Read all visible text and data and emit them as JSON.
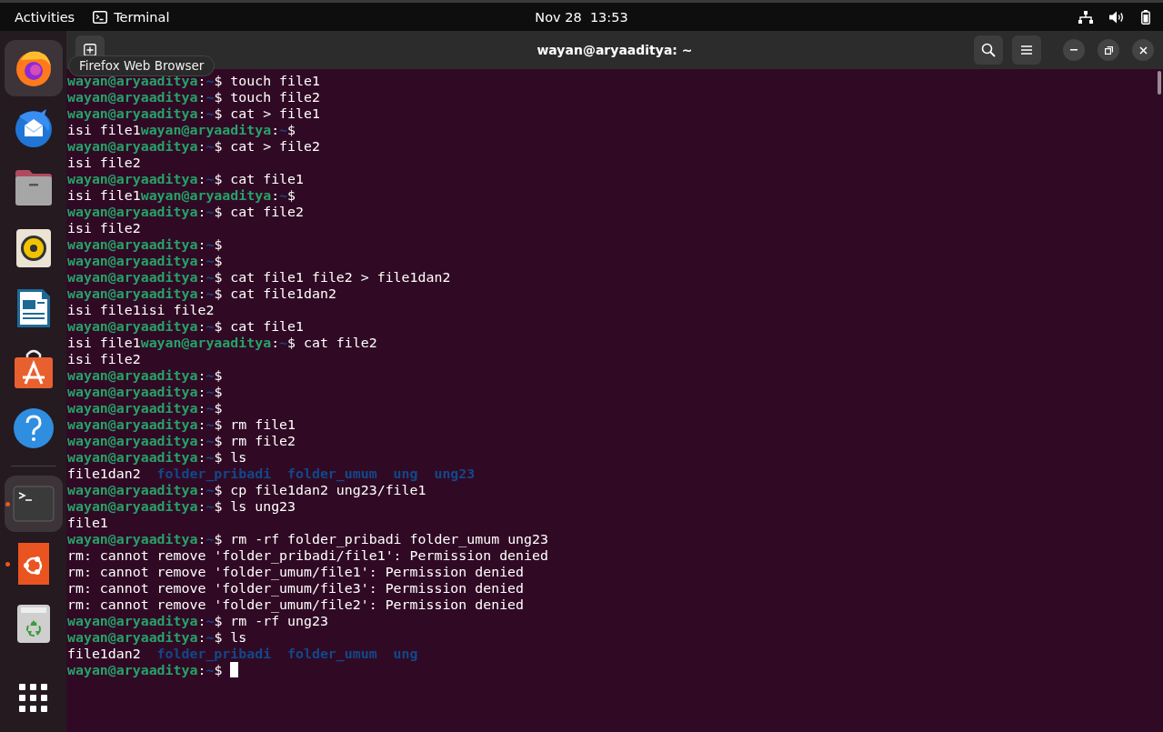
{
  "top_bar": {
    "activities": "Activities",
    "app_menu": "Terminal",
    "clock": "Nov 28  13:53"
  },
  "dock": {
    "tooltip": "Firefox Web Browser",
    "items": [
      {
        "kind": "firefox",
        "highlighted": true,
        "running": false
      },
      {
        "kind": "thunderbird",
        "highlighted": false,
        "running": false
      },
      {
        "kind": "files",
        "highlighted": false,
        "running": false
      },
      {
        "kind": "rhythmbox",
        "highlighted": false,
        "running": false
      },
      {
        "kind": "writer",
        "highlighted": false,
        "running": false
      },
      {
        "kind": "software",
        "highlighted": false,
        "running": false
      },
      {
        "kind": "help",
        "highlighted": false,
        "running": false
      },
      {
        "kind": "separator"
      },
      {
        "kind": "terminal",
        "highlighted": true,
        "running": true
      },
      {
        "kind": "ubuntu",
        "highlighted": false,
        "running": true
      },
      {
        "kind": "trash",
        "highlighted": false,
        "running": false
      },
      {
        "kind": "grid",
        "highlighted": false,
        "running": false
      }
    ]
  },
  "terminal": {
    "title": "wayan@aryaaditya: ~",
    "cursor": true,
    "lines": [
      [
        {
          "kind": "user",
          "text": "wayan@aryaaditya"
        },
        {
          "kind": "plain",
          "text": ":"
        },
        {
          "kind": "cwd",
          "text": "~"
        },
        {
          "kind": "plain",
          "text": "$ touch file1"
        }
      ],
      [
        {
          "kind": "user",
          "text": "wayan@aryaaditya"
        },
        {
          "kind": "plain",
          "text": ":"
        },
        {
          "kind": "cwd",
          "text": "~"
        },
        {
          "kind": "plain",
          "text": "$ touch file2"
        }
      ],
      [
        {
          "kind": "user",
          "text": "wayan@aryaaditya"
        },
        {
          "kind": "plain",
          "text": ":"
        },
        {
          "kind": "cwd",
          "text": "~"
        },
        {
          "kind": "plain",
          "text": "$ cat > file1"
        }
      ],
      [
        {
          "kind": "plain",
          "text": "isi file1"
        },
        {
          "kind": "user",
          "text": "wayan@aryaaditya"
        },
        {
          "kind": "plain",
          "text": ":"
        },
        {
          "kind": "cwd",
          "text": "~"
        },
        {
          "kind": "plain",
          "text": "$"
        }
      ],
      [
        {
          "kind": "user",
          "text": "wayan@aryaaditya"
        },
        {
          "kind": "plain",
          "text": ":"
        },
        {
          "kind": "cwd",
          "text": "~"
        },
        {
          "kind": "plain",
          "text": "$ cat > file2"
        }
      ],
      [
        {
          "kind": "plain",
          "text": "isi file2"
        }
      ],
      [
        {
          "kind": "user",
          "text": "wayan@aryaaditya"
        },
        {
          "kind": "plain",
          "text": ":"
        },
        {
          "kind": "cwd",
          "text": "~"
        },
        {
          "kind": "plain",
          "text": "$ cat file1"
        }
      ],
      [
        {
          "kind": "plain",
          "text": "isi file1"
        },
        {
          "kind": "user",
          "text": "wayan@aryaaditya"
        },
        {
          "kind": "plain",
          "text": ":"
        },
        {
          "kind": "cwd",
          "text": "~"
        },
        {
          "kind": "plain",
          "text": "$"
        }
      ],
      [
        {
          "kind": "user",
          "text": "wayan@aryaaditya"
        },
        {
          "kind": "plain",
          "text": ":"
        },
        {
          "kind": "cwd",
          "text": "~"
        },
        {
          "kind": "plain",
          "text": "$ cat file2"
        }
      ],
      [
        {
          "kind": "plain",
          "text": "isi file2"
        }
      ],
      [
        {
          "kind": "user",
          "text": "wayan@aryaaditya"
        },
        {
          "kind": "plain",
          "text": ":"
        },
        {
          "kind": "cwd",
          "text": "~"
        },
        {
          "kind": "plain",
          "text": "$"
        }
      ],
      [
        {
          "kind": "user",
          "text": "wayan@aryaaditya"
        },
        {
          "kind": "plain",
          "text": ":"
        },
        {
          "kind": "cwd",
          "text": "~"
        },
        {
          "kind": "plain",
          "text": "$"
        }
      ],
      [
        {
          "kind": "user",
          "text": "wayan@aryaaditya"
        },
        {
          "kind": "plain",
          "text": ":"
        },
        {
          "kind": "cwd",
          "text": "~"
        },
        {
          "kind": "plain",
          "text": "$ cat file1 file2 > file1dan2"
        }
      ],
      [
        {
          "kind": "user",
          "text": "wayan@aryaaditya"
        },
        {
          "kind": "plain",
          "text": ":"
        },
        {
          "kind": "cwd",
          "text": "~"
        },
        {
          "kind": "plain",
          "text": "$ cat file1dan2"
        }
      ],
      [
        {
          "kind": "plain",
          "text": "isi file1isi file2"
        }
      ],
      [
        {
          "kind": "user",
          "text": "wayan@aryaaditya"
        },
        {
          "kind": "plain",
          "text": ":"
        },
        {
          "kind": "cwd",
          "text": "~"
        },
        {
          "kind": "plain",
          "text": "$ cat file1"
        }
      ],
      [
        {
          "kind": "plain",
          "text": "isi file1"
        },
        {
          "kind": "user",
          "text": "wayan@aryaaditya"
        },
        {
          "kind": "plain",
          "text": ":"
        },
        {
          "kind": "cwd",
          "text": "~"
        },
        {
          "kind": "plain",
          "text": "$ cat file2"
        }
      ],
      [
        {
          "kind": "plain",
          "text": "isi file2"
        }
      ],
      [
        {
          "kind": "user",
          "text": "wayan@aryaaditya"
        },
        {
          "kind": "plain",
          "text": ":"
        },
        {
          "kind": "cwd",
          "text": "~"
        },
        {
          "kind": "plain",
          "text": "$"
        }
      ],
      [
        {
          "kind": "user",
          "text": "wayan@aryaaditya"
        },
        {
          "kind": "plain",
          "text": ":"
        },
        {
          "kind": "cwd",
          "text": "~"
        },
        {
          "kind": "plain",
          "text": "$"
        }
      ],
      [
        {
          "kind": "user",
          "text": "wayan@aryaaditya"
        },
        {
          "kind": "plain",
          "text": ":"
        },
        {
          "kind": "cwd",
          "text": "~"
        },
        {
          "kind": "plain",
          "text": "$"
        }
      ],
      [
        {
          "kind": "user",
          "text": "wayan@aryaaditya"
        },
        {
          "kind": "plain",
          "text": ":"
        },
        {
          "kind": "cwd",
          "text": "~"
        },
        {
          "kind": "plain",
          "text": "$ rm file1"
        }
      ],
      [
        {
          "kind": "user",
          "text": "wayan@aryaaditya"
        },
        {
          "kind": "plain",
          "text": ":"
        },
        {
          "kind": "cwd",
          "text": "~"
        },
        {
          "kind": "plain",
          "text": "$ rm file2"
        }
      ],
      [
        {
          "kind": "user",
          "text": "wayan@aryaaditya"
        },
        {
          "kind": "plain",
          "text": ":"
        },
        {
          "kind": "cwd",
          "text": "~"
        },
        {
          "kind": "plain",
          "text": "$ ls"
        }
      ],
      [
        {
          "kind": "plain",
          "text": "file1dan2"
        },
        {
          "kind": "dir",
          "text": "folder_pribadi"
        },
        {
          "kind": "dir",
          "text": "folder_umum"
        },
        {
          "kind": "dir",
          "text": "ung"
        },
        {
          "kind": "dir",
          "text": "ung23"
        }
      ],
      [
        {
          "kind": "user",
          "text": "wayan@aryaaditya"
        },
        {
          "kind": "plain",
          "text": ":"
        },
        {
          "kind": "cwd",
          "text": "~"
        },
        {
          "kind": "plain",
          "text": "$ cp file1dan2 ung23/file1"
        }
      ],
      [
        {
          "kind": "user",
          "text": "wayan@aryaaditya"
        },
        {
          "kind": "plain",
          "text": ":"
        },
        {
          "kind": "cwd",
          "text": "~"
        },
        {
          "kind": "plain",
          "text": "$ ls ung23"
        }
      ],
      [
        {
          "kind": "plain",
          "text": "file1"
        }
      ],
      [
        {
          "kind": "user",
          "text": "wayan@aryaaditya"
        },
        {
          "kind": "plain",
          "text": ":"
        },
        {
          "kind": "cwd",
          "text": "~"
        },
        {
          "kind": "plain",
          "text": "$ rm -rf folder_pribadi folder_umum ung23"
        }
      ],
      [
        {
          "kind": "plain",
          "text": "rm: cannot remove 'folder_pribadi/file1': Permission denied"
        }
      ],
      [
        {
          "kind": "plain",
          "text": "rm: cannot remove 'folder_umum/file1': Permission denied"
        }
      ],
      [
        {
          "kind": "plain",
          "text": "rm: cannot remove 'folder_umum/file3': Permission denied"
        }
      ],
      [
        {
          "kind": "plain",
          "text": "rm: cannot remove 'folder_umum/file2': Permission denied"
        }
      ],
      [
        {
          "kind": "user",
          "text": "wayan@aryaaditya"
        },
        {
          "kind": "plain",
          "text": ":"
        },
        {
          "kind": "cwd",
          "text": "~"
        },
        {
          "kind": "plain",
          "text": "$ rm -rf ung23"
        }
      ],
      [
        {
          "kind": "user",
          "text": "wayan@aryaaditya"
        },
        {
          "kind": "plain",
          "text": ":"
        },
        {
          "kind": "cwd",
          "text": "~"
        },
        {
          "kind": "plain",
          "text": "$ ls"
        }
      ],
      [
        {
          "kind": "plain",
          "text": "file1dan2"
        },
        {
          "kind": "dir",
          "text": "folder_pribadi"
        },
        {
          "kind": "dir",
          "text": "folder_umum"
        },
        {
          "kind": "dir",
          "text": "ung"
        }
      ],
      [
        {
          "kind": "user",
          "text": "wayan@aryaaditya"
        },
        {
          "kind": "plain",
          "text": ":"
        },
        {
          "kind": "cwd",
          "text": "~"
        },
        {
          "kind": "plain",
          "text": "$"
        }
      ]
    ]
  }
}
